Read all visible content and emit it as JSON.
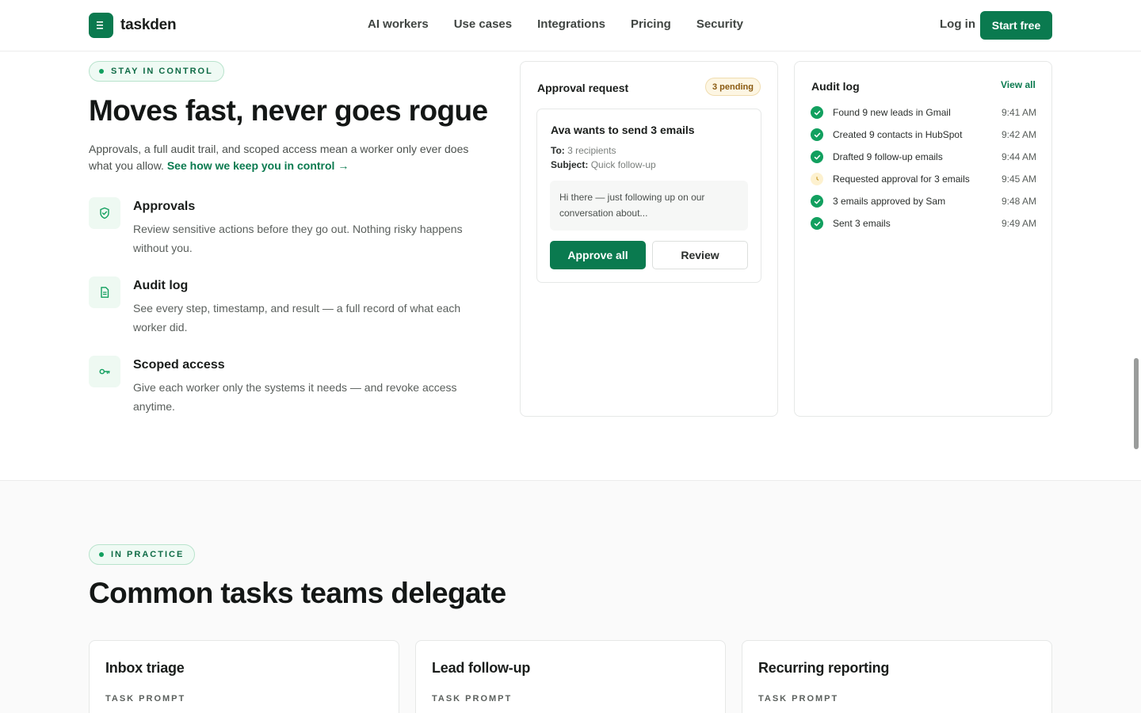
{
  "brand": {
    "name": "taskden"
  },
  "nav": {
    "items": [
      "AI workers",
      "Use cases",
      "Integrations",
      "Pricing",
      "Security"
    ],
    "login": "Log in",
    "cta": "Start free"
  },
  "control": {
    "eyebrow": "STAY IN CONTROL",
    "title": "Moves fast, never goes rogue",
    "lede": "Approvals, a full audit trail, and scoped access mean a worker only ever does what you allow.",
    "lede_link": "See how we keep you in control →",
    "features": [
      {
        "icon": "shield-check-icon",
        "title": "Approvals",
        "desc": "Review sensitive actions before they go out. Nothing risky happens without you."
      },
      {
        "icon": "document-icon",
        "title": "Audit log",
        "desc": "See every step, timestamp, and result — a full record of what each worker did."
      },
      {
        "icon": "key-icon",
        "title": "Scoped access",
        "desc": "Give each worker only the systems it needs — and revoke access anytime."
      }
    ]
  },
  "approval": {
    "title": "Approval request",
    "badge": "3 pending",
    "request_title": "Ava wants to send 3 emails",
    "to_label": "To:",
    "to_value": "3 recipients",
    "subject_label": "Subject:",
    "subject_value": "Quick follow-up",
    "preview": "Hi there — just following up on our conversation about...",
    "approve_label": "Approve all",
    "review_label": "Review"
  },
  "audit": {
    "title": "Audit log",
    "view_all": "View all",
    "entries": [
      {
        "text": "Found 9 new leads in Gmail",
        "time": "9:41 AM",
        "status": "done"
      },
      {
        "text": "Created 9 contacts in HubSpot",
        "time": "9:42 AM",
        "status": "done"
      },
      {
        "text": "Drafted 9 follow-up emails",
        "time": "9:44 AM",
        "status": "done"
      },
      {
        "text": "Requested approval for 3 emails",
        "time": "9:45 AM",
        "status": "pending"
      },
      {
        "text": "3 emails approved by Sam",
        "time": "9:48 AM",
        "status": "done"
      },
      {
        "text": "Sent 3 emails",
        "time": "9:49 AM",
        "status": "done"
      }
    ]
  },
  "practice": {
    "eyebrow": "IN PRACTICE",
    "title": "Common tasks teams delegate",
    "tasks": [
      {
        "title": "Inbox triage",
        "label": "TASK PROMPT"
      },
      {
        "title": "Lead follow-up",
        "label": "TASK PROMPT"
      },
      {
        "title": "Recurring reporting",
        "label": "TASK PROMPT"
      }
    ]
  },
  "colors": {
    "accent": "#0a7a4f",
    "success": "#12a05f",
    "pending": "#fdf1cf"
  }
}
